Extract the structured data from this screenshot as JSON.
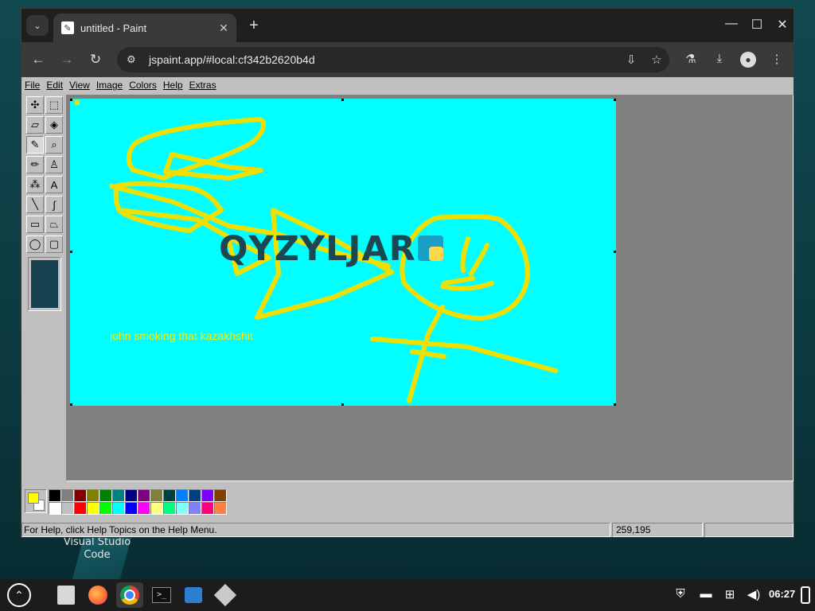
{
  "desktop": {
    "icon_label": "Visual Studio Code"
  },
  "browser": {
    "tab": {
      "title": "untitled - Paint",
      "close": "✕"
    },
    "new_tab": "+",
    "window_controls": {
      "minimize": "—",
      "maximize": "☐",
      "close": "✕"
    },
    "nav": {
      "back": "←",
      "forward": "→",
      "reload": "↻"
    },
    "url": "jspaint.app/#local:cf342b2620b4d",
    "icons": {
      "site_info": "site-info-icon",
      "install": "install-app-icon",
      "bookmark": "star-icon",
      "labs": "labs-flask-icon",
      "downloads": "download-icon",
      "profile": "profile-icon",
      "menu": "kebab-menu-icon"
    }
  },
  "paint": {
    "menu": [
      "File",
      "Edit",
      "View",
      "Image",
      "Colors",
      "Help",
      "Extras"
    ],
    "tools": [
      {
        "name": "free-form-select",
        "glyph": "✣"
      },
      {
        "name": "select",
        "glyph": "⬚"
      },
      {
        "name": "eraser",
        "glyph": "▱"
      },
      {
        "name": "fill-with-color",
        "glyph": "◈"
      },
      {
        "name": "pick-color",
        "glyph": "✎"
      },
      {
        "name": "magnifier",
        "glyph": "⌕"
      },
      {
        "name": "pencil",
        "glyph": "✏"
      },
      {
        "name": "brush",
        "glyph": "♙"
      },
      {
        "name": "airbrush",
        "glyph": "⁂"
      },
      {
        "name": "text",
        "glyph": "A"
      },
      {
        "name": "line",
        "glyph": "╲"
      },
      {
        "name": "curve",
        "glyph": "∫"
      },
      {
        "name": "rectangle",
        "glyph": "▭"
      },
      {
        "name": "polygon",
        "glyph": "⏢"
      },
      {
        "name": "ellipse",
        "glyph": "◯"
      },
      {
        "name": "rounded-rectangle",
        "glyph": "▢"
      }
    ],
    "active_tool": "pick-color",
    "canvas": {
      "background": "#00ffff",
      "title_text": "QYZYLJAR",
      "caption_text": "john smoking that kazakhshit"
    },
    "colors": {
      "primary": "#ffff00",
      "secondary": "#ffffff",
      "palette": [
        "#000000",
        "#808080",
        "#800000",
        "#808000",
        "#008000",
        "#008080",
        "#000080",
        "#800080",
        "#808040",
        "#004040",
        "#0080ff",
        "#004080",
        "#8000ff",
        "#804000",
        "#ffffff",
        "#c0c0c0",
        "#ff0000",
        "#ffff00",
        "#00ff00",
        "#00ffff",
        "#0000ff",
        "#ff00ff",
        "#ffff80",
        "#00ff80",
        "#80ffff",
        "#8080ff",
        "#ff0080",
        "#ff8040"
      ]
    },
    "status": {
      "help": "For Help, click Help Topics on the Help Menu.",
      "coords": "259,195",
      "size": ""
    }
  },
  "taskbar": {
    "apps": [
      "files",
      "firefox",
      "chrome",
      "terminal",
      "store",
      "app"
    ],
    "clock": "06:27"
  }
}
